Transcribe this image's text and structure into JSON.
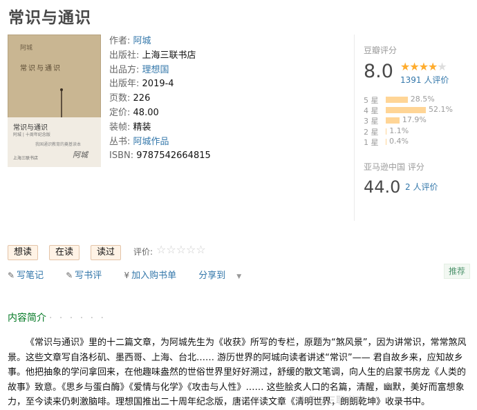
{
  "page_title": "常识与通识",
  "cover": {
    "author": "阿城",
    "book_name": "常识与通识",
    "lower_title": "常识与通识",
    "lower_sub": "阿城 | 十周年纪念版",
    "lower_line": "我国通识教育的奠基读本",
    "publisher": "上海三联书店",
    "signature": "阿城"
  },
  "info": [
    {
      "label": "作者:",
      "value": "阿城",
      "link": true
    },
    {
      "label": "出版社:",
      "value": "上海三联书店",
      "link": false
    },
    {
      "label": "出品方:",
      "value": "理想国",
      "link": true
    },
    {
      "label": "出版年:",
      "value": "2019-4",
      "link": false
    },
    {
      "label": "页数:",
      "value": "226",
      "link": false
    },
    {
      "label": "定价:",
      "value": "48.00",
      "link": false
    },
    {
      "label": "装帧:",
      "value": "精装",
      "link": false
    },
    {
      "label": "丛书:",
      "value": "阿城作品",
      "link": true
    },
    {
      "label": "ISBN:",
      "value": "9787542664815",
      "link": false
    }
  ],
  "douban": {
    "title": "豆瓣评分",
    "score": "8.0",
    "stars_filled": 4,
    "count_text": "1391 人评价",
    "distribution": [
      {
        "label": "5 星",
        "percent": 28.5,
        "text": "28.5%"
      },
      {
        "label": "4 星",
        "percent": 52.1,
        "text": "52.1%"
      },
      {
        "label": "3 星",
        "percent": 17.9,
        "text": "17.9%"
      },
      {
        "label": "2 星",
        "percent": 1.1,
        "text": "1.1%"
      },
      {
        "label": "1 星",
        "percent": 0.4,
        "text": "0.4%"
      }
    ]
  },
  "amazon": {
    "title": "亚马逊中国 评分",
    "score": "44.0",
    "count_text": "2 人评价"
  },
  "actions": {
    "want": "想读",
    "reading": "在读",
    "read": "读过",
    "rate_label": "评价:"
  },
  "links": {
    "note": "写笔记",
    "review": "写书评",
    "cart": "加入购书单",
    "share": "分享到"
  },
  "recommend": "推荐",
  "intro": {
    "heading": "内容简介",
    "dots": "· · · · · ·",
    "text": "《常识与通识》里的十二篇文章，为阿城先生为《收获》所写的专栏，原题为“煞风景”，因为讲常识，常常煞风景。这些文章写自洛杉矶、墨西哥、上海、台北…… 游历世界的阿城向读者讲述“常识”—— 君自故乡来，应知故乡事。他把抽象的学问拿回来，在他趣味盎然的世俗世界里好好溯过，舒缓的散文笔调，向人生的启蒙书房龙《人类的故事》致意。《思乡与蛋白酶》《爱情与化学》《攻击与人性》…… 这些脍炙人口的名篇，清醒，幽默，美好而富想象力，至今读来仍刺激脑啡。理想国推出二十周年纪念版，唐诺伴读文章《清明世界，朗朗乾坤》收录书中。"
  },
  "watermark": "头条@三联书店"
}
